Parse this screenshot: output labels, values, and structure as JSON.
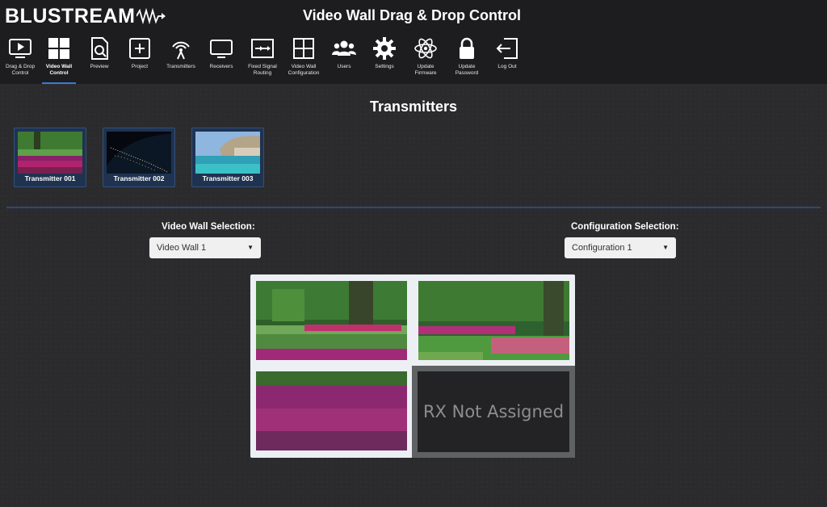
{
  "header": {
    "logo": "BLUSTREAM",
    "title": "Video Wall Drag & Drop Control"
  },
  "nav": [
    {
      "label": "Drag & Drop\nControl",
      "icon": "play-screen-icon"
    },
    {
      "label": "Video Wall\nControl",
      "icon": "video-wall-grid-icon",
      "active": true
    },
    {
      "label": "Preview",
      "icon": "preview-document-icon"
    },
    {
      "label": "Project",
      "icon": "project-plus-icon"
    },
    {
      "label": "Transmitters",
      "icon": "transmitter-antenna-icon"
    },
    {
      "label": "Receivers",
      "icon": "receiver-monitor-icon"
    },
    {
      "label": "Fixed Signal\nRouting",
      "icon": "signal-routing-icon"
    },
    {
      "label": "Video Wall\nConfiguration",
      "icon": "wall-configuration-icon"
    },
    {
      "label": "Users",
      "icon": "users-icon"
    },
    {
      "label": "Settings",
      "icon": "gear-icon"
    },
    {
      "label": "Update\nFirmware",
      "icon": "atom-firmware-icon"
    },
    {
      "label": "Update\nPassword",
      "icon": "lock-icon"
    },
    {
      "label": "Log Out",
      "icon": "logout-icon"
    }
  ],
  "transmitters": {
    "title": "Transmitters",
    "items": [
      {
        "label": "Transmitter 001",
        "thumb": "tulip-garden"
      },
      {
        "label": "Transmitter 002",
        "thumb": "earth-night"
      },
      {
        "label": "Transmitter 003",
        "thumb": "coastal-village"
      }
    ]
  },
  "video_wall_selection": {
    "label": "Video Wall Selection:",
    "value": "Video Wall 1"
  },
  "configuration_selection": {
    "label": "Configuration Selection:",
    "value": "Configuration 1"
  },
  "wall": {
    "empty_label": "RX Not Assigned"
  },
  "colors": {
    "accent": "#3a7bd5",
    "card": "#1f3350",
    "header": "#1d1d1f"
  }
}
